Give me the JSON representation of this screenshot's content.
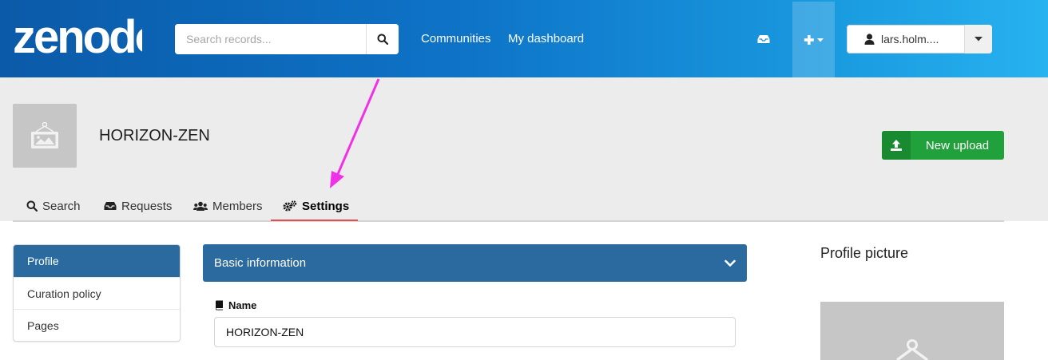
{
  "header": {
    "logo_text": "zenodo",
    "search": {
      "placeholder": "Search records...",
      "value": ""
    },
    "nav": {
      "communities": "Communities",
      "dashboard": "My dashboard"
    },
    "icons": {
      "search": "search-icon",
      "inbox": "inbox-icon",
      "plus": "plus-icon",
      "user": "user-icon"
    },
    "user": {
      "name": "lars.holm...."
    }
  },
  "community": {
    "title": "HORIZON-ZEN",
    "new_upload_label": "New upload",
    "tabs": [
      {
        "label": "Search",
        "icon": "search-icon"
      },
      {
        "label": "Requests",
        "icon": "inbox-icon"
      },
      {
        "label": "Members",
        "icon": "users-icon"
      },
      {
        "label": "Settings",
        "icon": "cogs-icon",
        "active": true
      }
    ]
  },
  "settings": {
    "menu": [
      {
        "label": "Profile",
        "active": true
      },
      {
        "label": "Curation policy"
      },
      {
        "label": "Pages"
      }
    ],
    "basic_info": {
      "title": "Basic information",
      "name_label": "Name",
      "name_value": "HORIZON-ZEN"
    },
    "profile_picture_title": "Profile picture"
  },
  "colors": {
    "header_from": "#0b5aa8",
    "header_to": "#27b2f0",
    "primary": "#2b6a9e",
    "success": "#21a13b",
    "annotation_arrow": "#f032e6",
    "tab_active_underline": "#e05252"
  }
}
